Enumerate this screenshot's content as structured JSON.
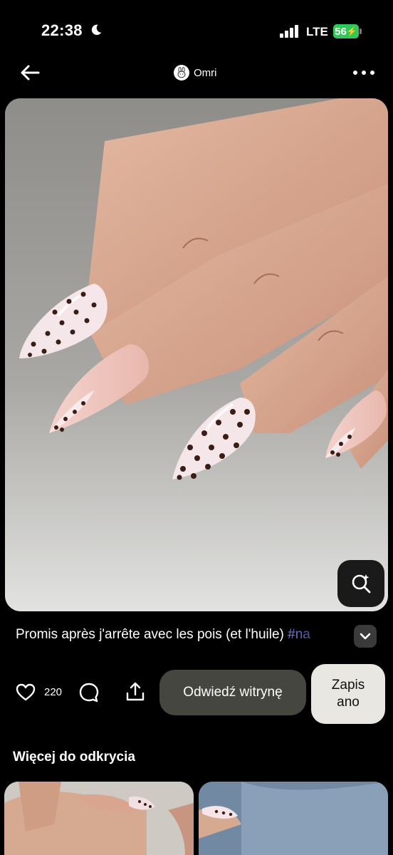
{
  "status_bar": {
    "time": "22:38",
    "network": "LTE",
    "battery": "56"
  },
  "header": {
    "author_name": "Omri",
    "icons": [
      "back-arrow-icon",
      "more-dots-icon"
    ]
  },
  "pin": {
    "image_subject": "almond nails with pink base and brown polka dots",
    "lens_icon": "visual-search-icon",
    "description": "Promis après j'arrête avec les pois (et l'huile) ",
    "hashtag": "#na"
  },
  "actions": {
    "like_count": "220",
    "visit_label": "Odwiedź witrynę",
    "save_label": "Zapis ano"
  },
  "more_section": {
    "title": "Więcej do odkrycia"
  },
  "colors": {
    "background": "#000000",
    "visit_button": "#45463f",
    "save_button": "#e9e7e2",
    "hashtag": "#7f8cff",
    "battery": "#32c759"
  }
}
